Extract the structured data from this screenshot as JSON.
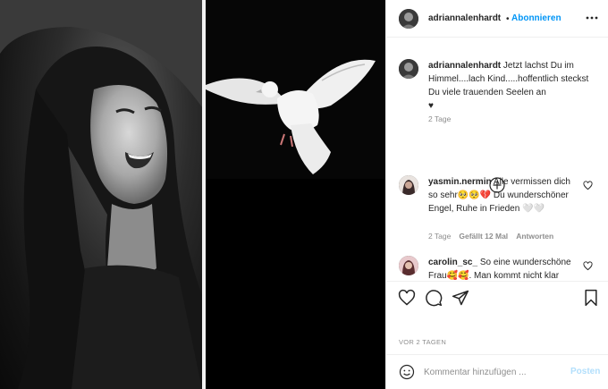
{
  "header": {
    "username": "adriannalenhardt",
    "separator": "•",
    "follow_label": "Abonnieren"
  },
  "caption": {
    "username": "adriannalenhardt",
    "text": "Jetzt lachst Du im Himmel....lach Kind.....hoffentlich steckst Du viele trauenden Seelen an",
    "heart": "♥",
    "time": "2 Tage"
  },
  "comments": [
    {
      "username": "yasmin.nermin",
      "text": "Alle vermissen dich so sehr🥺🥺💔 Du wunderschöner Engel, Ruhe in Frieden 🤍🤍",
      "time": "2 Tage",
      "likes": "Gefällt 12 Mal",
      "reply": "Antworten"
    },
    {
      "username": "carolin_sc_",
      "text": "So eine wunderschöne Frau🥰🥰. Man kommt nicht klar",
      "time": "",
      "likes": "",
      "reply": ""
    }
  ],
  "date": "VOR 2 TAGEN",
  "composer": {
    "placeholder": "Kommentar hinzufügen ...",
    "post_label": "Posten"
  },
  "icons": [
    "more-icon",
    "plus-circle-icon",
    "heart-icon",
    "comment-icon",
    "share-icon",
    "bookmark-icon",
    "emoji-icon"
  ],
  "colors": {
    "accent": "#0095f6",
    "post_disabled": "#b2dffc",
    "muted": "#8e8e8e",
    "border": "#efefef"
  }
}
